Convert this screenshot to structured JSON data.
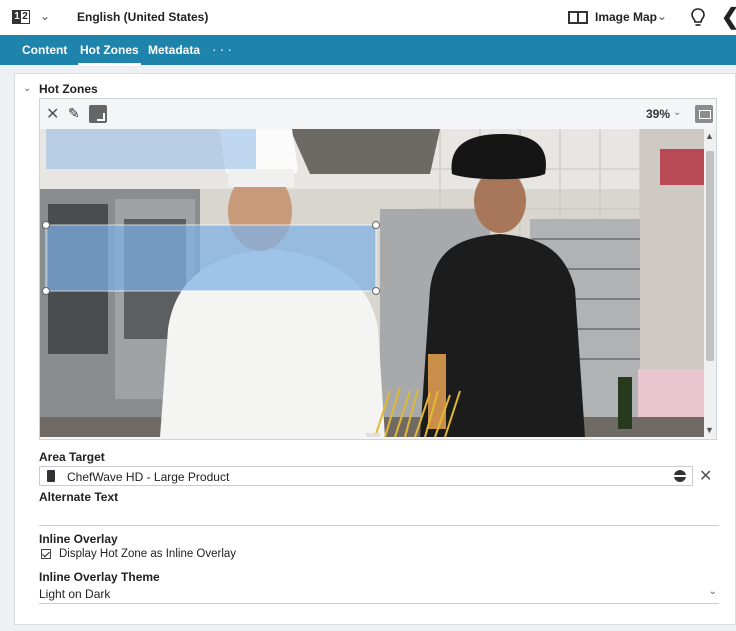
{
  "topbar": {
    "lang_icon_left": "1",
    "lang_icon_right": "2",
    "language": "English (United States)",
    "view_label": "Image Map"
  },
  "tabs": [
    {
      "label": "Content",
      "active": false
    },
    {
      "label": "Hot Zones",
      "active": true
    },
    {
      "label": "Metadata",
      "active": false
    }
  ],
  "tabs_more": "···",
  "section": {
    "title": "Hot Zones"
  },
  "editor": {
    "zoom": "39%",
    "image_alt": "chefs"
  },
  "form": {
    "area_target_label": "Area Target",
    "area_target_value": "ChefWave HD - Large Product",
    "alt_text_label": "Alternate Text",
    "alt_text_value": "",
    "inline_overlay_label": "Inline Overlay",
    "inline_overlay_checkbox_label": "Display Hot Zone as Inline Overlay",
    "inline_overlay_checked": true,
    "theme_label": "Inline Overlay Theme",
    "theme_value": "Light on Dark"
  },
  "colors": {
    "tabbar": "#1e84ac",
    "hotzone_fill": "#7fb2e6"
  }
}
